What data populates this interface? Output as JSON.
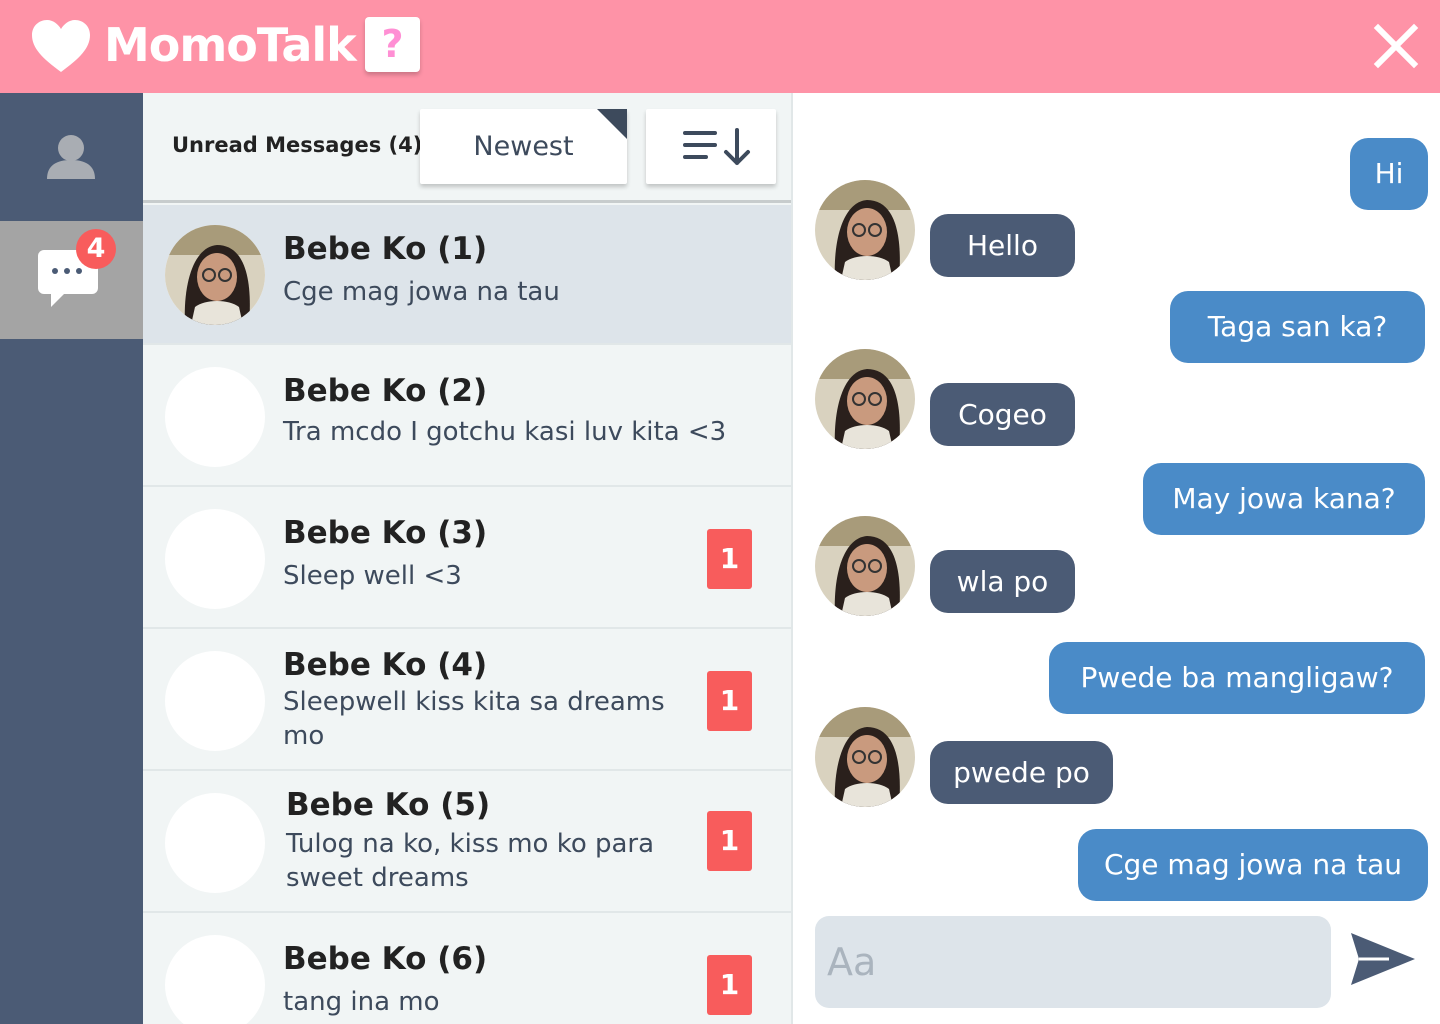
{
  "app": {
    "title": "MomoTalk",
    "help_label": "?"
  },
  "rail": {
    "unread_badge": "4"
  },
  "list": {
    "header_label": "Unread Messages (4)",
    "sort_label": "Newest",
    "conversations": [
      {
        "name": "Bebe Ko (1)",
        "preview": "Cge mag jowa na tau",
        "badge": "",
        "has_photo": true
      },
      {
        "name": "Bebe Ko (2)",
        "preview": "Tra mcdo I gotchu kasi luv kita <3",
        "badge": "",
        "has_photo": false
      },
      {
        "name": "Bebe Ko (3)",
        "preview": "Sleep well <3",
        "badge": "1",
        "has_photo": false
      },
      {
        "name": "Bebe Ko (4)",
        "preview": "Sleepwell kiss kita sa dreams mo",
        "badge": "1",
        "has_photo": false
      },
      {
        "name": "Bebe Ko (5)",
        "preview": "Tulog na ko, kiss mo ko para sweet dreams",
        "badge": "1",
        "has_photo": false
      },
      {
        "name": "Bebe Ko (6)",
        "preview": "tang ina mo",
        "badge": "1",
        "has_photo": false
      }
    ]
  },
  "chat": {
    "messages": [
      {
        "dir": "out",
        "text": "Hi"
      },
      {
        "dir": "in",
        "text": "Hello"
      },
      {
        "dir": "out",
        "text": "Taga san ka?"
      },
      {
        "dir": "in",
        "text": "Cogeo"
      },
      {
        "dir": "out",
        "text": "May jowa kana?"
      },
      {
        "dir": "in",
        "text": "wla po"
      },
      {
        "dir": "out",
        "text": "Pwede ba mangligaw?"
      },
      {
        "dir": "in",
        "text": "pwede po"
      },
      {
        "dir": "out",
        "text": "Cge mag jowa na tau"
      }
    ],
    "composer_placeholder": "Aa"
  },
  "colors": {
    "header": "#fe93a7",
    "rail": "#4b5b75",
    "outgoing": "#4a8bc8",
    "incoming": "#4b5b75",
    "badge": "#f85c5c"
  }
}
